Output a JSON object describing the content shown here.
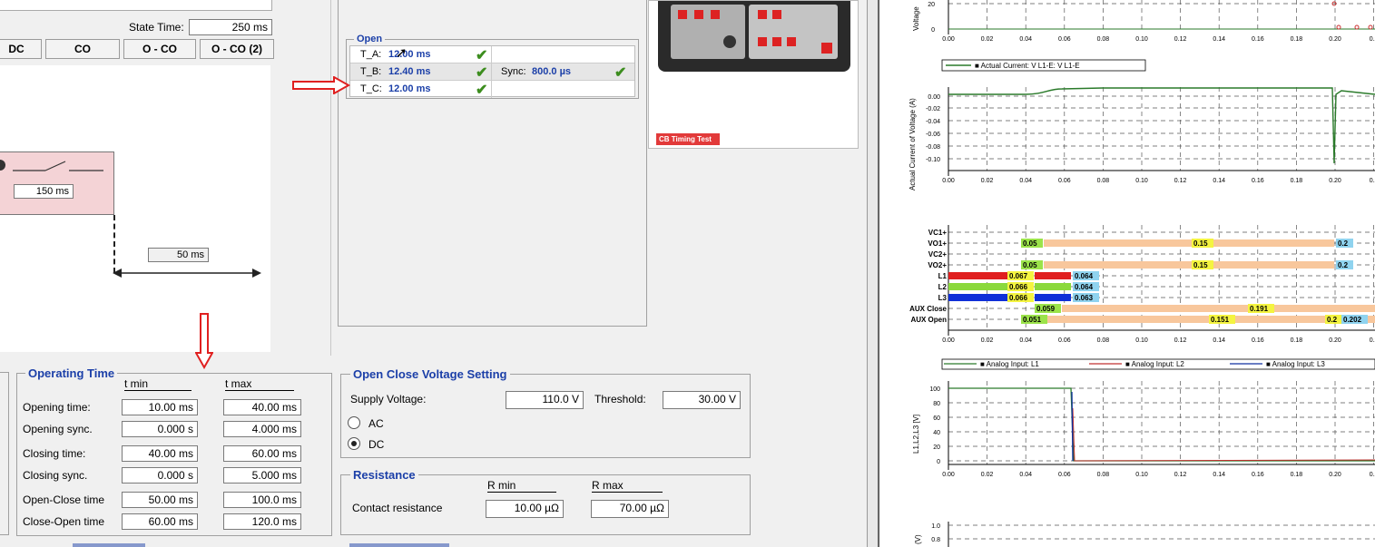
{
  "state_time": {
    "label": "State Time:",
    "value": "250 ms"
  },
  "sequence_buttons": [
    "DC",
    "CO",
    "O - CO",
    "O - CO (2)"
  ],
  "diagram": {
    "close_time": "150 ms",
    "delay": "50 ms"
  },
  "open_panel": {
    "title": "Open",
    "rows": [
      {
        "label": "T_A:",
        "value": "12.00 ms"
      },
      {
        "label": "T_B:",
        "value": "12.40 ms"
      },
      {
        "label": "T_C:",
        "value": "12.00 ms"
      }
    ],
    "sync_label": "Sync:",
    "sync_value": "800.0 µs"
  },
  "device_label": "CB Timing Test",
  "operating_time": {
    "title": "Operating Time",
    "col_min": "t min",
    "col_max": "t max",
    "rows": [
      {
        "label": "Opening time:",
        "min": "10.00 ms",
        "max": "40.00 ms"
      },
      {
        "label": "Opening sync.",
        "min": "0.000 s",
        "max": "4.000 ms"
      },
      {
        "label": "Closing time:",
        "min": "40.00 ms",
        "max": "60.00 ms"
      },
      {
        "label": "Closing sync.",
        "min": "0.000 s",
        "max": "5.000 ms"
      },
      {
        "label": "Open-Close time",
        "min": "50.00 ms",
        "max": "100.0 ms"
      },
      {
        "label": "Close-Open time",
        "min": "60.00 ms",
        "max": "120.0 ms"
      }
    ]
  },
  "voltage_setting": {
    "title": "Open Close Voltage Setting",
    "supply_label": "Supply Voltage:",
    "supply_value": "110.0 V",
    "threshold_label": "Threshold:",
    "threshold_value": "30.00 V",
    "options": [
      "AC",
      "DC"
    ],
    "selected": "DC"
  },
  "resistance": {
    "title": "Resistance",
    "col_min": "R min",
    "col_max": "R max",
    "label": "Contact resistance",
    "min": "10.00 µΩ",
    "max": "70.00 µΩ"
  },
  "charts": {
    "x_ticks": [
      "0.00",
      "0.02",
      "0.04",
      "0.06",
      "0.08",
      "0.10",
      "0.12",
      "0.14",
      "0.16",
      "0.18",
      "0.20",
      "0.2"
    ],
    "voltage_ylabel": "Voltage",
    "voltage_ticks": [
      "20",
      "0"
    ],
    "current_legend": "Actual Current: V L1-E: V L1-E",
    "current_ylabel": "Actual Current of Voltage (A)",
    "current_ticks": [
      "0.00",
      "-0.02",
      "-0.04",
      "-0.06",
      "-0.08",
      "-0.10"
    ],
    "binary_rows": [
      {
        "name": "VC1+",
        "marks": []
      },
      {
        "name": "VO1+",
        "marks": [
          "0.05",
          "0.15",
          "0.2"
        ]
      },
      {
        "name": "VC2+",
        "marks": []
      },
      {
        "name": "VO2+",
        "marks": [
          "0.05",
          "0.15",
          "0.2"
        ]
      },
      {
        "name": "L1",
        "marks": [
          "0.067",
          "0.064"
        ]
      },
      {
        "name": "L2",
        "marks": [
          "0.066",
          "0.064"
        ]
      },
      {
        "name": "L3",
        "marks": [
          "0.066",
          "0.063"
        ]
      },
      {
        "name": "AUX Close",
        "marks": [
          "0.059",
          "0.191"
        ]
      },
      {
        "name": "AUX Open",
        "marks": [
          "0.051",
          "0.151",
          "0.2",
          "0.202"
        ]
      }
    ],
    "analog_legend": [
      "Analog Input: L1",
      "Analog Input: L2",
      "Analog Input: L3"
    ],
    "analog_ylabel": "L1,L2,L3 [V]",
    "analog_ticks": [
      "100",
      "80",
      "60",
      "40",
      "20",
      "0"
    ],
    "bottom_ylabel": "(V)",
    "bottom_ticks": [
      "1.0",
      "0.8"
    ]
  },
  "colors": {
    "accent": "#1b3fa8",
    "check": "#3c8d1e",
    "red": "#e02020"
  }
}
